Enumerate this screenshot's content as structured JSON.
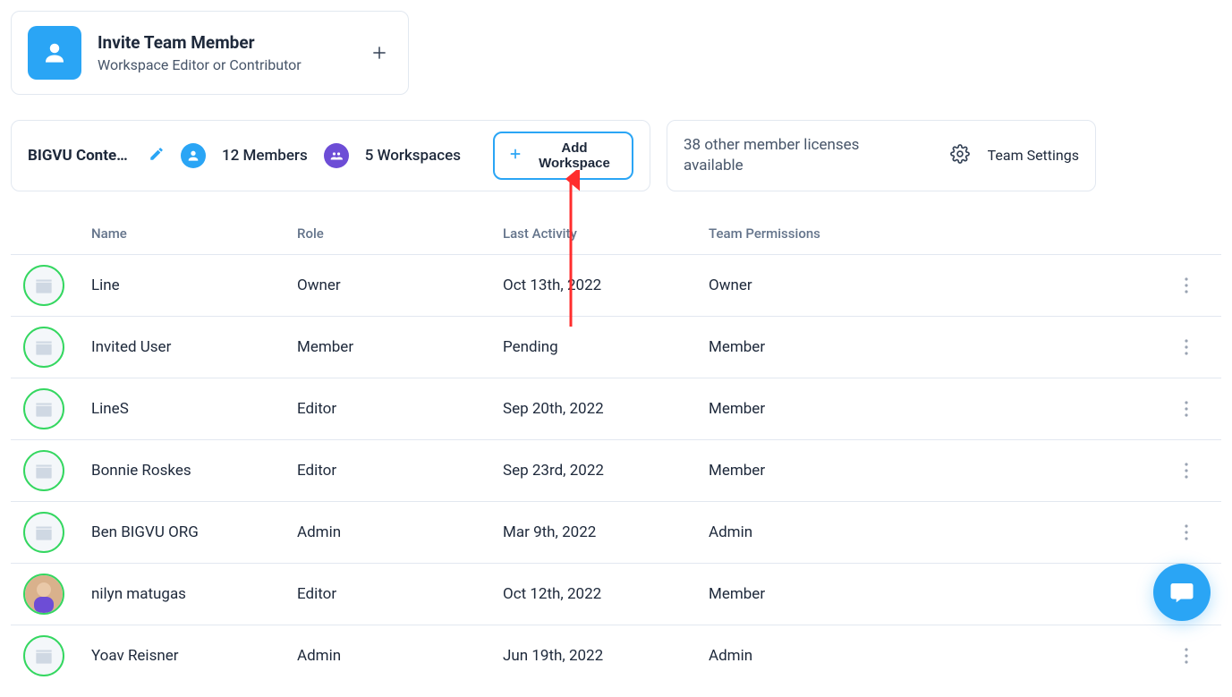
{
  "invite": {
    "title": "Invite Team Member",
    "subtitle": "Workspace Editor or Contributor"
  },
  "team_bar": {
    "name": "BIGVU Content...",
    "members_label": "12 Members",
    "workspaces_label": "5 Workspaces",
    "add_workspace_label": "Add Workspace"
  },
  "licenses_bar": {
    "licenses_text": "38 other member licenses available",
    "settings_label": "Team Settings"
  },
  "table": {
    "headers": {
      "name": "Name",
      "role": "Role",
      "last_activity": "Last Activity",
      "permissions": "Team Permissions"
    },
    "rows": [
      {
        "name": "Line",
        "role": "Owner",
        "last_activity": "Oct 13th, 2022",
        "permissions": "Owner",
        "avatar_kind": "clapper"
      },
      {
        "name": "Invited User",
        "role": "Member",
        "last_activity": "Pending",
        "permissions": "Member",
        "avatar_kind": "clapper"
      },
      {
        "name": "LineS",
        "role": "Editor",
        "last_activity": "Sep 20th, 2022",
        "permissions": "Member",
        "avatar_kind": "clapper"
      },
      {
        "name": "Bonnie Roskes",
        "role": "Editor",
        "last_activity": "Sep 23rd, 2022",
        "permissions": "Member",
        "avatar_kind": "clapper"
      },
      {
        "name": "Ben BIGVU ORG",
        "role": "Admin",
        "last_activity": "Mar 9th, 2022",
        "permissions": "Admin",
        "avatar_kind": "clapper"
      },
      {
        "name": "nilyn matugas",
        "role": "Editor",
        "last_activity": "Oct 12th, 2022",
        "permissions": "Member",
        "avatar_kind": "photo"
      },
      {
        "name": "Yoav Reisner",
        "role": "Admin",
        "last_activity": "Jun 19th, 2022",
        "permissions": "Admin",
        "avatar_kind": "clapper"
      }
    ]
  },
  "colors": {
    "accent_blue": "#2aa5f5",
    "accent_purple": "#6d4dd6",
    "avatar_ring": "#34d760",
    "border": "#e2e8f0",
    "annotation_red": "#ff2d2d"
  }
}
